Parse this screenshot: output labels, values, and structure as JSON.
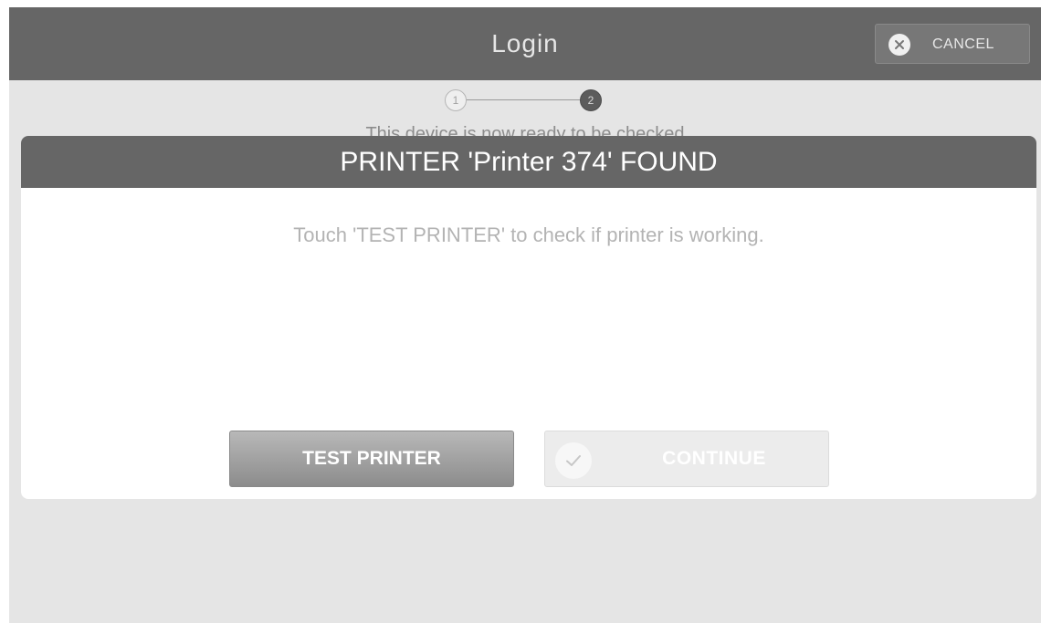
{
  "header": {
    "title": "Login",
    "cancel_label": "CANCEL",
    "cancel_icon": "close-circle-icon"
  },
  "stepper": {
    "steps": [
      "1",
      "2"
    ],
    "current_step": 2
  },
  "background": {
    "partial_text": "This device is now ready to be checked"
  },
  "dialog": {
    "title": "PRINTER 'Printer 374' FOUND",
    "message": "Touch 'TEST PRINTER' to check if printer is working.",
    "test_button_label": "TEST PRINTER",
    "continue_button_label": "CONTINUE",
    "continue_icon": "checkmark-circle-icon"
  },
  "colors": {
    "header_bg": "#666666",
    "screen_bg": "#e5e5e5",
    "dialog_bg": "#ffffff"
  }
}
